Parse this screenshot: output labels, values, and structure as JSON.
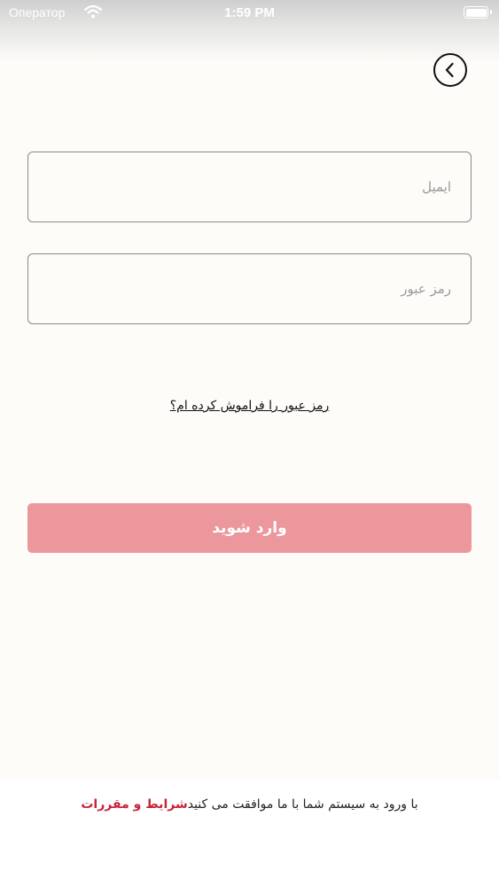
{
  "status_bar": {
    "carrier": "Оператор",
    "time": "1:59 PM"
  },
  "login": {
    "email_placeholder": "ایمیل",
    "password_placeholder": "رمز عبور",
    "forgot_password": "رمز عبور را فراموش کرده ام؟",
    "submit_label": "وارد شوید"
  },
  "footer": {
    "agreement_text": "با ورود به سیستم شما با ما موافقت می کنید",
    "terms_link": "شرایط و مقررات"
  },
  "colors": {
    "accent": "#eb979c",
    "link": "#c8243a",
    "background": "#fdfcf9"
  },
  "icons": {
    "back": "chevron-left-icon",
    "wifi": "wifi-icon",
    "battery": "battery-icon"
  }
}
